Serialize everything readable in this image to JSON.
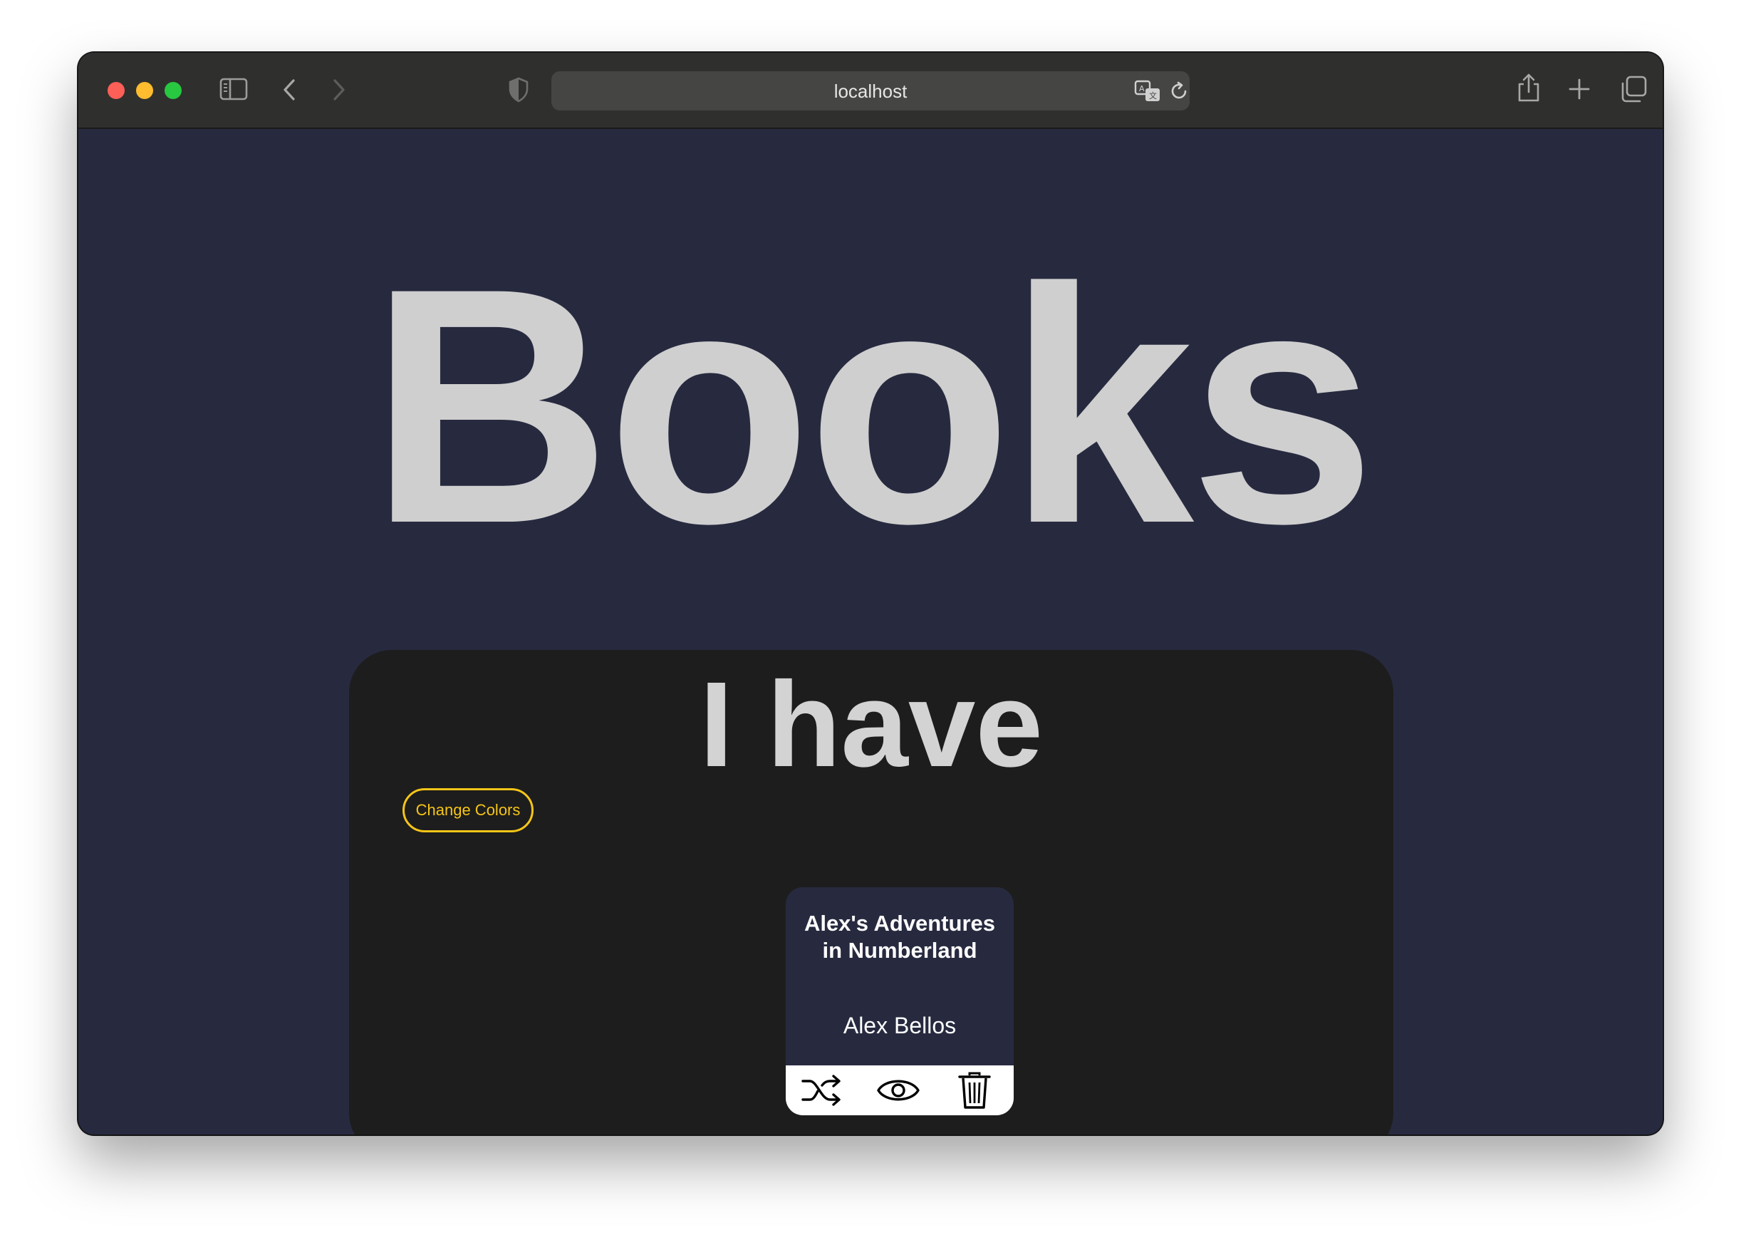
{
  "browser": {
    "url": "localhost",
    "icons": {
      "sidebar": "sidebar-icon",
      "back": "chevron-left-icon",
      "forward": "chevron-right-icon",
      "privacy": "shield-icon",
      "translate": "translate-icon",
      "reload": "reload-icon",
      "share": "share-icon",
      "new_tab": "plus-icon",
      "tabs": "tab-overview-icon"
    }
  },
  "page": {
    "title": "Books",
    "section": {
      "title": "I have",
      "change_colors_label": "Change Colors",
      "books": [
        {
          "title": "Alex's Adventures in Numberland",
          "author": "Alex Bellos",
          "actions": [
            "shuffle-icon",
            "eye-icon",
            "trash-icon"
          ]
        }
      ]
    }
  },
  "colors": {
    "page_background": "#272a3f",
    "panel_background": "#1d1d1d",
    "heading_text": "#cfcfcf",
    "accent": "#f5c518",
    "card_background": "#272a3f"
  }
}
